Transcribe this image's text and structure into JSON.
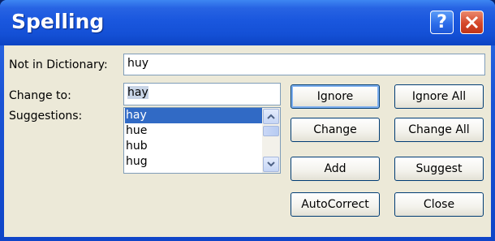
{
  "window": {
    "title": "Spelling"
  },
  "titlebar": {
    "help_label": "?",
    "close_label": "✕"
  },
  "labels": {
    "not_in_dictionary": "Not in Dictionary:",
    "change_to": "Change to:",
    "suggestions": "Suggestions:"
  },
  "fields": {
    "not_in_dictionary_value": "huy",
    "change_to_value": "hay"
  },
  "suggestions": [
    "hay",
    "hue",
    "hub",
    "hug"
  ],
  "selected_suggestion": "hay",
  "buttons": {
    "ignore": "Ignore",
    "ignore_all": "Ignore All",
    "change": "Change",
    "change_all": "Change All",
    "add": "Add",
    "suggest": "Suggest",
    "autocorrect": "AutoCorrect",
    "close": "Close"
  },
  "icons": {
    "help": "help-icon",
    "close": "close-icon",
    "scroll_up": "chevron-up-icon",
    "scroll_down": "chevron-down-icon"
  },
  "colors": {
    "titlebar": "#1a57de",
    "close_button": "#d5472a",
    "dialog_bg": "#ece9d8",
    "selection": "#316ac5"
  }
}
